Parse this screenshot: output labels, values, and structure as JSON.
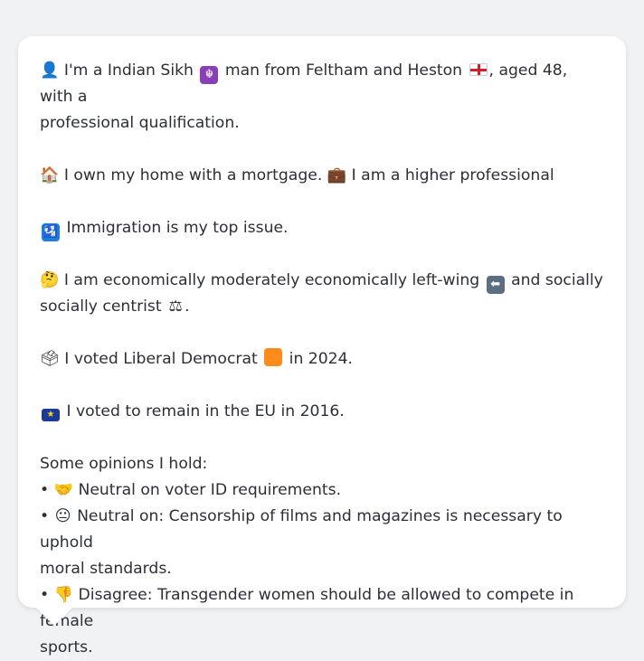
{
  "persona": {
    "intro_icon": "👤",
    "intro_pre": "I'm a Indian Sikh",
    "religion_icon": "☬",
    "intro_mid": "man from Feltham and Heston",
    "flag_icon": "england-flag",
    "intro_post": ", aged 48, with a",
    "intro_line2": "professional qualification.",
    "home_icon": "🏠",
    "home_text": "I own my home with a mortgage.",
    "work_icon": "💼",
    "work_text": "I am a higher professional",
    "issue_icon": "🛂",
    "issue_text": "Immigration is my top issue.",
    "econ_icon": "🤔",
    "econ_text": "I am economically moderately economically left-wing",
    "left_icon": "⬅",
    "econ_text2": "and socially",
    "social_text": "socially centrist",
    "scales_icon": "⚖",
    "social_end": ".",
    "vote_icon": "🗳",
    "vote_pre": "I voted Liberal Democrat",
    "party_color": "#ff8c1a",
    "vote_post": "in 2024.",
    "eu_icon": "eu-flag",
    "eu_text": "I voted to remain in the EU in 2016.",
    "opinions_heading": "Some opinions I hold:",
    "opinions": [
      {
        "bullet": "•",
        "icon": "🤝",
        "line1": "Neutral on voter ID requirements.",
        "line2": ""
      },
      {
        "bullet": "•",
        "icon": "😐",
        "line1": "Neutral on: Censorship of films and magazines is necessary to uphold",
        "line2": "moral standards."
      },
      {
        "bullet": "•",
        "icon": "👎",
        "line1": "Disagree: Transgender women should be allowed to compete in female",
        "line2": "sports."
      }
    ]
  }
}
